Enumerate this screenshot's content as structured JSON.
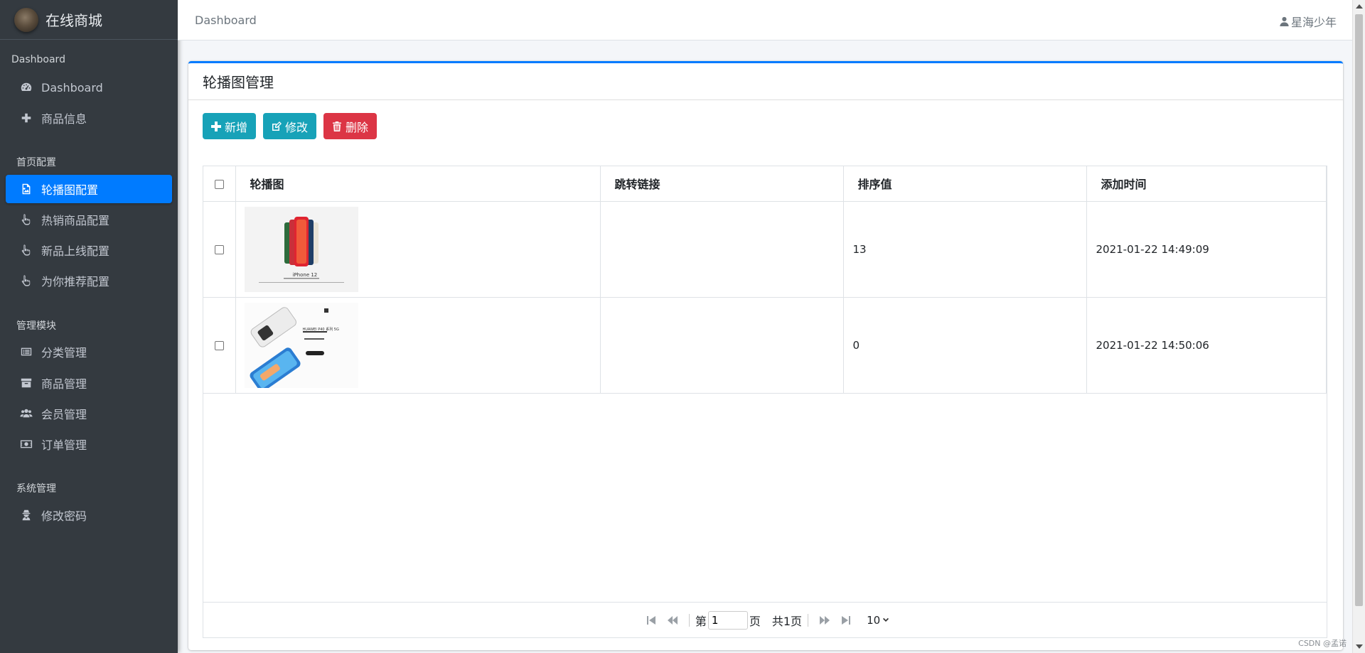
{
  "sidebar": {
    "brand": "在线商城",
    "sections": [
      {
        "header": "Dashboard",
        "items": [
          {
            "label": "Dashboard",
            "icon": "tachometer-icon"
          },
          {
            "label": "商品信息",
            "icon": "plus-icon"
          }
        ]
      },
      {
        "header": "首页配置",
        "items": [
          {
            "label": "轮播图配置",
            "icon": "image-icon",
            "active": true
          },
          {
            "label": "热销商品配置",
            "icon": "hand-pointer-icon"
          },
          {
            "label": "新品上线配置",
            "icon": "hand-pointer-icon"
          },
          {
            "label": "为你推荐配置",
            "icon": "hand-pointer-icon"
          }
        ]
      },
      {
        "header": "管理模块",
        "items": [
          {
            "label": "分类管理",
            "icon": "list-alt-icon"
          },
          {
            "label": "商品管理",
            "icon": "archive-icon"
          },
          {
            "label": "会员管理",
            "icon": "users-icon"
          },
          {
            "label": "订单管理",
            "icon": "money-bill-icon"
          }
        ]
      },
      {
        "header": "系统管理",
        "items": [
          {
            "label": "修改密码",
            "icon": "user-secret-icon"
          }
        ]
      }
    ]
  },
  "topbar": {
    "breadcrumb": "Dashboard",
    "username": "星海少年"
  },
  "card": {
    "title": "轮播图管理",
    "buttons": {
      "add": "新增",
      "edit": "修改",
      "delete": "删除"
    }
  },
  "table": {
    "columns": [
      "轮播图",
      "跳转链接",
      "排序值",
      "添加时间"
    ],
    "rows": [
      {
        "image": "iPhone 12 banner",
        "image_caption": "iPhone 12",
        "link": "",
        "sort": "13",
        "created": "2021-01-22 14:49:09"
      },
      {
        "image": "HUAWEI P40 banner",
        "image_caption": "HUAWEI P40 系列 5G",
        "link": "",
        "sort": "0",
        "created": "2021-01-22 14:50:06"
      }
    ]
  },
  "pager": {
    "page_prefix": "第",
    "page_value": "1",
    "page_suffix": "页",
    "total": "共1页",
    "page_size": "10"
  },
  "watermark": "CSDN @孟诺",
  "colors": {
    "sidebar_bg": "#343a40",
    "primary": "#007bff",
    "info": "#17a2b8",
    "danger": "#dc3545"
  }
}
